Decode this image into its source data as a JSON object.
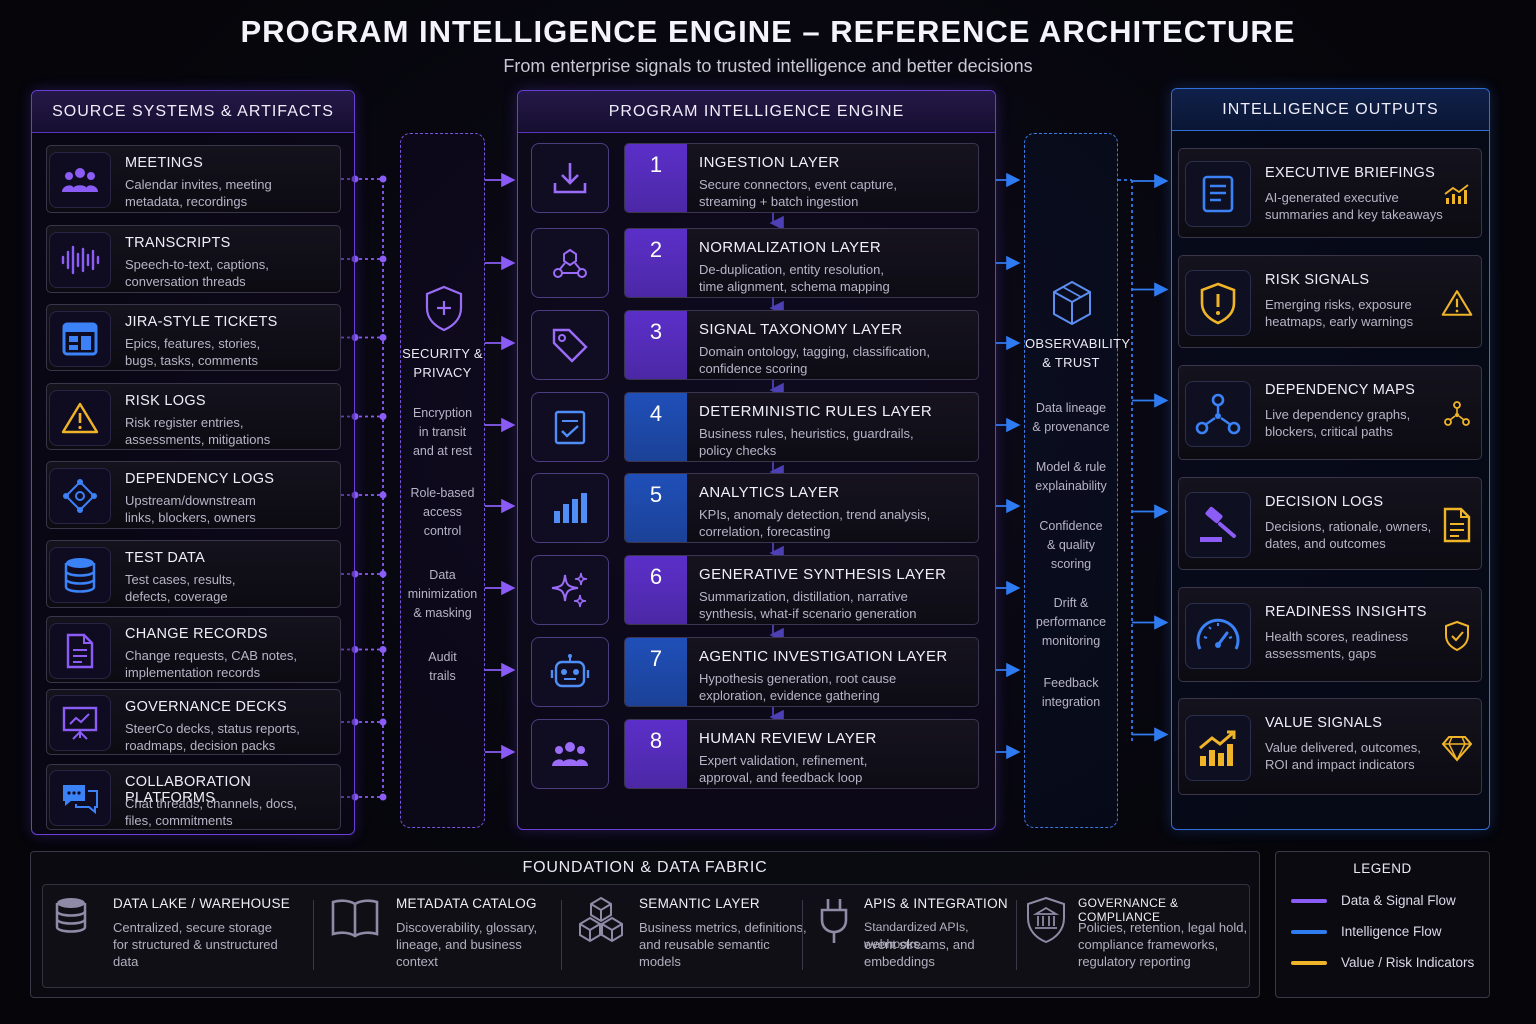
{
  "header": {
    "title": "PROGRAM INTELLIGENCE ENGINE – REFERENCE ARCHITECTURE",
    "subtitle": "From enterprise signals to trusted intelligence and better decisions"
  },
  "sources": {
    "title": "SOURCE SYSTEMS & ARTIFACTS",
    "items": [
      {
        "title": "MEETINGS",
        "desc1": "Calendar invites, meeting",
        "desc2": "metadata, recordings",
        "icon": "people-icon"
      },
      {
        "title": "TRANSCRIPTS",
        "desc1": "Speech-to-text, captions,",
        "desc2": "conversation threads",
        "icon": "waveform-icon"
      },
      {
        "title": "JIRA-STYLE TICKETS",
        "desc1": "Epics, features, stories,",
        "desc2": "bugs, tasks, comments",
        "icon": "board-icon"
      },
      {
        "title": "RISK LOGS",
        "desc1": "Risk register entries,",
        "desc2": "assessments, mitigations",
        "icon": "warning-icon"
      },
      {
        "title": "DEPENDENCY LOGS",
        "desc1": "Upstream/downstream",
        "desc2": "links, blockers, owners",
        "icon": "network-icon"
      },
      {
        "title": "TEST DATA",
        "desc1": "Test cases, results,",
        "desc2": "defects, coverage",
        "icon": "database-icon"
      },
      {
        "title": "CHANGE RECORDS",
        "desc1": "Change requests, CAB notes,",
        "desc2": "implementation records",
        "icon": "document-icon"
      },
      {
        "title": "GOVERNANCE DECKS",
        "desc1": "SteerCo decks, status reports,",
        "desc2": "roadmaps, decision packs",
        "icon": "presentation-icon"
      },
      {
        "title": "COLLABORATION PLATFORMS",
        "desc1": "Chat threads, channels, docs,",
        "desc2": "files, commitments",
        "icon": "chat-icon"
      }
    ]
  },
  "security": {
    "title1": "SECURITY &",
    "title2": "PRIVACY",
    "items": [
      [
        "Encryption",
        "in transit",
        "and at rest"
      ],
      [
        "Role-based",
        "access",
        "control"
      ],
      [
        "Data",
        "minimization",
        "& masking"
      ],
      [
        "Audit",
        "trails"
      ]
    ]
  },
  "engine": {
    "title": "PROGRAM INTELLIGENCE ENGINE",
    "layers": [
      {
        "num": "1",
        "title": "INGESTION LAYER",
        "desc1": "Secure connectors, event capture,",
        "desc2": "streaming + batch ingestion",
        "icon": "download-icon"
      },
      {
        "num": "2",
        "title": "NORMALIZATION LAYER",
        "desc1": "De-duplication, entity resolution,",
        "desc2": "time alignment, schema mapping",
        "icon": "nodes-icon"
      },
      {
        "num": "3",
        "title": "SIGNAL TAXONOMY LAYER",
        "desc1": "Domain ontology, tagging, classification,",
        "desc2": "confidence scoring",
        "icon": "tag-icon"
      },
      {
        "num": "4",
        "title": "DETERMINISTIC RULES LAYER",
        "desc1": "Business rules, heuristics, guardrails,",
        "desc2": "policy checks",
        "icon": "checklist-icon"
      },
      {
        "num": "5",
        "title": "ANALYTICS LAYER",
        "desc1": "KPIs, anomaly detection, trend analysis,",
        "desc2": "correlation, forecasting",
        "icon": "bar-chart-icon"
      },
      {
        "num": "6",
        "title": "GENERATIVE SYNTHESIS LAYER",
        "desc1": "Summarization, distillation, narrative",
        "desc2": "synthesis, what-if scenario generation",
        "icon": "sparkles-icon"
      },
      {
        "num": "7",
        "title": "AGENTIC INVESTIGATION LAYER",
        "desc1": "Hypothesis generation, root cause",
        "desc2": "exploration, evidence gathering",
        "icon": "robot-icon"
      },
      {
        "num": "8",
        "title": "HUMAN REVIEW LAYER",
        "desc1": "Expert validation, refinement,",
        "desc2": "approval, and feedback loop",
        "icon": "people-icon"
      }
    ]
  },
  "observability": {
    "title1": "OBSERVABILITY",
    "title2": "& TRUST",
    "items": [
      [
        "Data lineage",
        "& provenance"
      ],
      [
        "Model & rule",
        "explainability"
      ],
      [
        "Confidence",
        "& quality",
        "scoring"
      ],
      [
        "Drift &",
        "performance",
        "monitoring"
      ],
      [
        "Feedback",
        "integration"
      ]
    ]
  },
  "outputs": {
    "title": "INTELLIGENCE OUTPUTS",
    "items": [
      {
        "title": "EXECUTIVE BRIEFINGS",
        "desc1": "AI-generated executive",
        "desc2": "summaries and key takeaways",
        "icon": "briefing-icon",
        "badge": "trend-chart-icon"
      },
      {
        "title": "RISK SIGNALS",
        "desc1": "Emerging risks, exposure",
        "desc2": "heatmaps, early warnings",
        "icon": "shield-alert-icon",
        "badge": "warning-icon"
      },
      {
        "title": "DEPENDENCY MAPS",
        "desc1": "Live dependency graphs,",
        "desc2": "blockers, critical paths",
        "icon": "graph-icon",
        "badge": "org-chart-icon"
      },
      {
        "title": "DECISION LOGS",
        "desc1": "Decisions, rationale, owners,",
        "desc2": "dates, and outcomes",
        "icon": "gavel-icon",
        "badge": "document-icon"
      },
      {
        "title": "READINESS INSIGHTS",
        "desc1": "Health scores, readiness",
        "desc2": "assessments, gaps",
        "icon": "gauge-icon",
        "badge": "shield-check-icon"
      },
      {
        "title": "VALUE SIGNALS",
        "desc1": "Value delivered, outcomes,",
        "desc2": "ROI and impact indicators",
        "icon": "growth-chart-icon",
        "badge": "diamond-icon"
      }
    ]
  },
  "foundation": {
    "title": "FOUNDATION & DATA FABRIC",
    "items": [
      {
        "title": "DATA LAKE / WAREHOUSE",
        "desc1": "Centralized, secure storage",
        "desc2": "for structured & unstructured",
        "desc3": "data",
        "icon": "database-icon"
      },
      {
        "title": "METADATA CATALOG",
        "desc1": "Discoverability, glossary,",
        "desc2": "lineage, and business",
        "desc3": "context",
        "icon": "book-icon"
      },
      {
        "title": "SEMANTIC LAYER",
        "desc1": "Business metrics, definitions,",
        "desc2": "and reusable semantic",
        "desc3": "models",
        "icon": "cubes-icon"
      },
      {
        "title": "APIS & INTEGRATION",
        "desc1": "Standardized APIs, webhooks,",
        "desc2": "event streams, and",
        "desc3": "embeddings",
        "icon": "plug-icon"
      },
      {
        "title": "GOVERNANCE & COMPLIANCE",
        "desc1": "Policies, retention, legal hold,",
        "desc2": "compliance frameworks,",
        "desc3": "regulatory reporting",
        "icon": "institution-icon"
      }
    ]
  },
  "legend": {
    "title": "LEGEND",
    "items": [
      {
        "label": "Data & Signal Flow",
        "color": "#8b5cf6"
      },
      {
        "label": "Intelligence Flow",
        "color": "#2f7bf0"
      },
      {
        "label": "Value / Risk Indicators",
        "color": "#f0b429"
      }
    ]
  },
  "colors": {
    "purple": "#8b5cf6",
    "blue": "#2f7bf0",
    "gold": "#f0b429"
  }
}
